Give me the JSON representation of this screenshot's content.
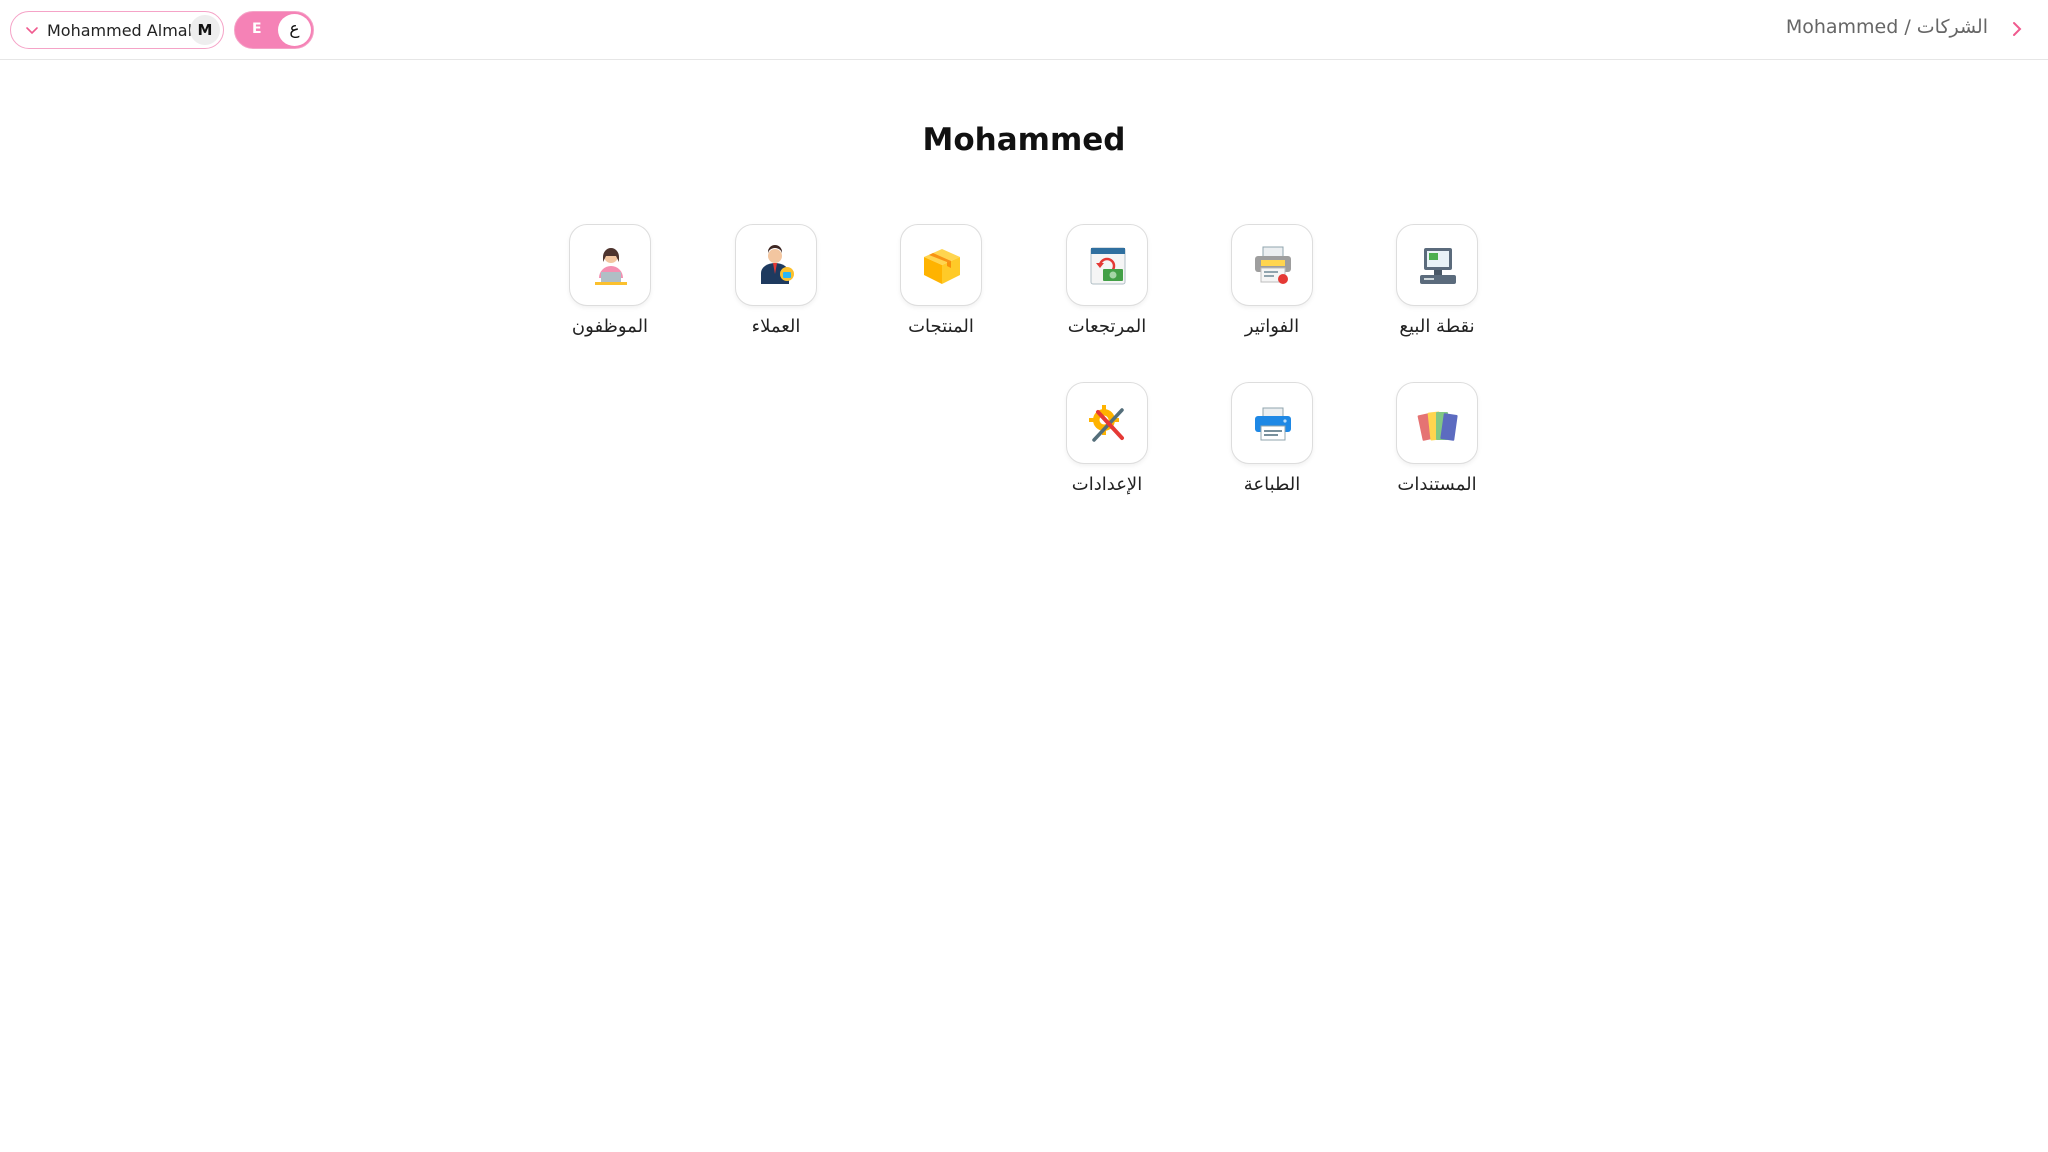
{
  "header": {
    "user_name": "Mohammed Almalki",
    "user_initial": "M",
    "lang_active": "E",
    "lang_other": "ع",
    "breadcrumb": "Mohammed / الشركات"
  },
  "page": {
    "title": "Mohammed"
  },
  "apps": [
    {
      "label": "نقطة البيع",
      "icon": "pos-terminal-icon"
    },
    {
      "label": "الفواتير",
      "icon": "invoice-printer-icon"
    },
    {
      "label": "المرتجعات",
      "icon": "refund-icon"
    },
    {
      "label": "المنتجات",
      "icon": "box-icon"
    },
    {
      "label": "العملاء",
      "icon": "customer-icon"
    },
    {
      "label": "الموظفون",
      "icon": "employee-icon"
    },
    {
      "label": "المستندات",
      "icon": "folders-icon"
    },
    {
      "label": "الطباعة",
      "icon": "printer-icon"
    },
    {
      "label": "الإعدادات",
      "icon": "settings-tools-icon"
    }
  ],
  "colors": {
    "accent": "#f582b6",
    "accent_border": "#f5a3c7",
    "breadcrumb_chevron": "#f05a8e"
  }
}
